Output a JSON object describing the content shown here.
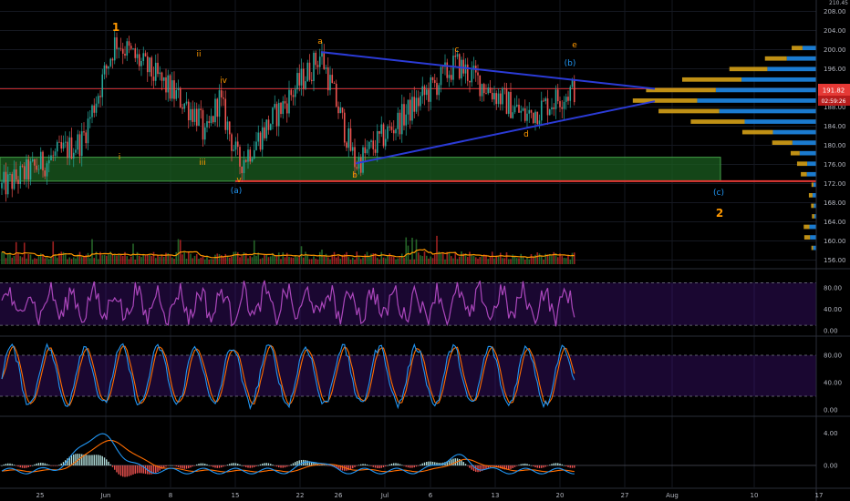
{
  "colors": {
    "background": "#000000",
    "grid": "#151821",
    "up_candle": "#26a69a",
    "down_candle": "#ef5350",
    "wave_label": "#ff9800",
    "wave_label_alt": "#2196f3",
    "triangle": "#2b3bd6",
    "support_zone": "#1b5e20",
    "resistance_line": "#e53935",
    "rsi": "#ab47bc",
    "stoch_k": "#2196f3",
    "stoch_d": "#ff6d00",
    "macd": "#2196f3",
    "signal": "#ff6d00",
    "vol_ma": "#ff9800",
    "vp_up": "#1e88e5",
    "vp_down": "#d4a017"
  },
  "header": {
    "top_right_clip": "210.45"
  },
  "price_badges": {
    "last_price": "191.82",
    "countdown": "02:59:26"
  },
  "time_axis": {
    "labels": [
      "25",
      "Jun",
      "8",
      "15",
      "22",
      "26",
      "Jul",
      "6",
      "13",
      "20",
      "27",
      "Aug",
      "10",
      "17"
    ]
  },
  "wave_labels": [
    {
      "text": "1",
      "style": "big-orange"
    },
    {
      "text": "i",
      "style": "orange"
    },
    {
      "text": "ii",
      "style": "orange"
    },
    {
      "text": "iii",
      "style": "orange"
    },
    {
      "text": "iv",
      "style": "orange"
    },
    {
      "text": "v",
      "style": "orange"
    },
    {
      "text": "(a)",
      "style": "blue"
    },
    {
      "text": "a",
      "style": "orange"
    },
    {
      "text": "b",
      "style": "orange"
    },
    {
      "text": "c",
      "style": "orange"
    },
    {
      "text": "d",
      "style": "orange"
    },
    {
      "text": "e",
      "style": "orange"
    },
    {
      "text": "(b)",
      "style": "blue"
    },
    {
      "text": "(c)",
      "style": "blue"
    },
    {
      "text": "2",
      "style": "big-orange"
    }
  ],
  "chart_data": [
    {
      "type": "candlestick",
      "panel": "price",
      "ylim": [
        154,
        210
      ],
      "yticks": [
        156,
        160,
        164,
        168,
        172,
        176,
        180,
        184,
        188,
        192,
        196,
        200,
        204,
        208
      ],
      "key_points": [
        {
          "label": "start",
          "price": 171
        },
        {
          "label": "i",
          "price": 181
        },
        {
          "label": "1",
          "price": 202
        },
        {
          "label": "ii",
          "price": 186
        },
        {
          "label": "iii",
          "price": 181
        },
        {
          "label": "iv",
          "price": 190
        },
        {
          "label": "v",
          "price": 176
        },
        {
          "label": "a",
          "price": 199
        },
        {
          "label": "b",
          "price": 176
        },
        {
          "label": "c",
          "price": 197
        },
        {
          "label": "d",
          "price": 186
        },
        {
          "label": "e",
          "price": 191.8
        }
      ],
      "support_zone": [
        172.5,
        177.5
      ],
      "resistance_line": 172.5,
      "current_price_line": 191.8
    },
    {
      "type": "line",
      "panel": "rsi",
      "ylim": [
        0,
        100
      ],
      "yticks": [
        0,
        40,
        80
      ],
      "tick_labels": [
        "0.00",
        "40.00",
        "80.00"
      ],
      "bands": [
        10,
        90
      ]
    },
    {
      "type": "line",
      "panel": "stochastic",
      "ylim": [
        0,
        100
      ],
      "yticks": [
        0,
        40,
        80
      ],
      "tick_labels": [
        "0.00",
        "40.00",
        "80.00"
      ],
      "bands": [
        20,
        80
      ]
    },
    {
      "type": "bar",
      "panel": "macd",
      "ylim": [
        -2.5,
        6
      ],
      "yticks": [
        0,
        4
      ],
      "tick_labels": [
        "0.00",
        "4.00"
      ]
    }
  ]
}
